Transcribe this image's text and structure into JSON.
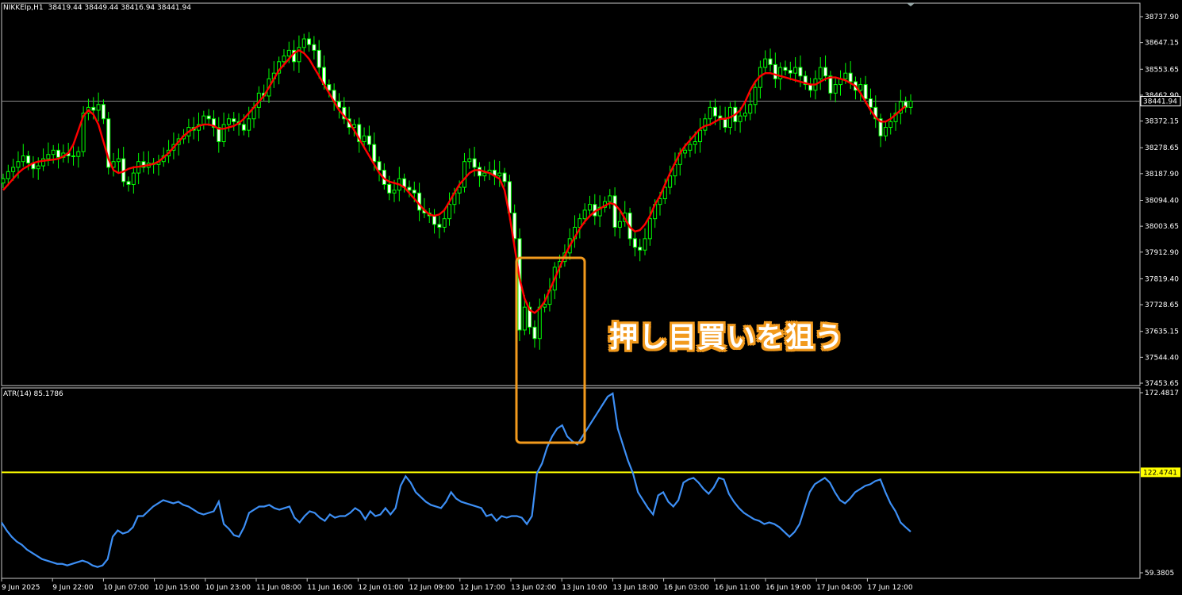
{
  "header": {
    "symbol": "NIKKEIp,H1",
    "ohlc": "38419.44 38449.44 38416.94 38441.94"
  },
  "indicator": {
    "label": "ATR(14) 85.1786"
  },
  "annotation": {
    "text": "押し目買いを狙う"
  },
  "colors": {
    "background": "#000000",
    "frame": "#c8c8c8",
    "candle": "#00ff00",
    "ma": "#ff0000",
    "atr": "#3d8ff5",
    "level": "#ffff00",
    "highlight": "#f29a1d"
  },
  "chart_data": [
    {
      "type": "candlestick",
      "title": "NIKKEIp,H1",
      "ylim": [
        37453.65,
        38787.0
      ],
      "y_ticks": [
        "38737.90",
        "38647.15",
        "38553.65",
        "38462.90",
        "38372.15",
        "38278.65",
        "38187.90",
        "38094.40",
        "38003.65",
        "37912.90",
        "37819.40",
        "37728.65",
        "37635.15",
        "37544.40",
        "37453.65"
      ],
      "y_tick_values": [
        38737.9,
        38647.15,
        38553.65,
        38462.9,
        38372.15,
        38278.65,
        38187.9,
        38094.4,
        38003.65,
        37912.9,
        37819.4,
        37728.65,
        37635.15,
        37544.4,
        37453.65
      ],
      "current_price": 38441.94,
      "current_price_label": "38441.94",
      "x_tick_labels": [
        "9 Jun 2025",
        "9 Jun 22:00",
        "10 Jun 07:00",
        "10 Jun 15:00",
        "10 Jun 23:00",
        "11 Jun 08:00",
        "11 Jun 16:00",
        "12 Jun 01:00",
        "12 Jun 09:00",
        "12 Jun 17:00",
        "13 Jun 02:00",
        "13 Jun 10:00",
        "13 Jun 18:00",
        "16 Jun 03:00",
        "16 Jun 11:00",
        "16 Jun 19:00",
        "17 Jun 04:00",
        "17 Jun 12:00"
      ],
      "candle_closes": [
        38170,
        38195,
        38210,
        38230,
        38250,
        38225,
        38205,
        38215,
        38240,
        38255,
        38270,
        38245,
        38260,
        38250,
        38248,
        38265,
        38400,
        38420,
        38410,
        38430,
        38380,
        38210,
        38230,
        38240,
        38160,
        38150,
        38190,
        38230,
        38210,
        38225,
        38220,
        38230,
        38250,
        38270,
        38290,
        38310,
        38320,
        38350,
        38340,
        38360,
        38390,
        38380,
        38350,
        38300,
        38360,
        38380,
        38370,
        38360,
        38340,
        38380,
        38420,
        38470,
        38460,
        38520,
        38540,
        38580,
        38600,
        38620,
        38580,
        38630,
        38660,
        38640,
        38620,
        38560,
        38500,
        38480,
        38440,
        38420,
        38380,
        38350,
        38360,
        38300,
        38320,
        38290,
        38230,
        38200,
        38150,
        38120,
        38130,
        38170,
        38140,
        38130,
        38120,
        38060,
        38050,
        38040,
        38010,
        38000,
        38030,
        38080,
        38120,
        38140,
        38230,
        38240,
        38210,
        38180,
        38190,
        38200,
        38180,
        38190,
        38160,
        38050,
        37960,
        37640,
        37720,
        37650,
        37610,
        37720,
        37730,
        37780,
        37860,
        37880,
        37910,
        37960,
        38000,
        38030,
        38060,
        38080,
        38040,
        38070,
        38090,
        38110,
        38000,
        38020,
        38050,
        37960,
        37930,
        37920,
        37960,
        38030,
        38080,
        38100,
        38140,
        38180,
        38220,
        38260,
        38270,
        38290,
        38300,
        38340,
        38380,
        38420,
        38390,
        38380,
        38350,
        38420,
        38370,
        38390,
        38400,
        38430,
        38490,
        38560,
        38590,
        38570,
        38520,
        38560,
        38550,
        38540,
        38560,
        38530,
        38500,
        38480,
        38520,
        38560,
        38530,
        38470,
        38500,
        38520,
        38540,
        38510,
        38480,
        38500,
        38450,
        38420,
        38380,
        38320,
        38350,
        38370,
        38400,
        38440,
        38420,
        38441.94
      ],
      "ma_values": [
        38130,
        38150,
        38170,
        38190,
        38205,
        38215,
        38225,
        38230,
        38233,
        38235,
        38237,
        38240,
        38248,
        38260,
        38290,
        38340,
        38390,
        38410,
        38395,
        38360,
        38300,
        38240,
        38200,
        38190,
        38195,
        38205,
        38210,
        38212,
        38215,
        38218,
        38222,
        38230,
        38245,
        38260,
        38280,
        38300,
        38320,
        38335,
        38345,
        38355,
        38360,
        38360,
        38355,
        38345,
        38345,
        38350,
        38355,
        38365,
        38380,
        38400,
        38420,
        38440,
        38460,
        38490,
        38520,
        38550,
        38570,
        38590,
        38610,
        38620,
        38610,
        38590,
        38560,
        38530,
        38500,
        38470,
        38440,
        38410,
        38390,
        38370,
        38340,
        38310,
        38280,
        38250,
        38220,
        38190,
        38170,
        38160,
        38155,
        38150,
        38140,
        38120,
        38100,
        38080,
        38060,
        38045,
        38040,
        38045,
        38060,
        38090,
        38120,
        38150,
        38170,
        38190,
        38200,
        38200,
        38195,
        38190,
        38180,
        38170,
        38130,
        38040,
        37930,
        37820,
        37750,
        37710,
        37700,
        37715,
        37740,
        37780,
        37820,
        37860,
        37900,
        37935,
        37965,
        37995,
        38020,
        38040,
        38055,
        38065,
        38075,
        38085,
        38080,
        38060,
        38030,
        38000,
        37985,
        37990,
        38010,
        38040,
        38080,
        38110,
        38150,
        38190,
        38225,
        38260,
        38285,
        38305,
        38325,
        38345,
        38355,
        38360,
        38370,
        38380,
        38380,
        38385,
        38395,
        38410,
        38440,
        38480,
        38510,
        38530,
        38540,
        38540,
        38535,
        38530,
        38525,
        38520,
        38515,
        38510,
        38505,
        38500,
        38500,
        38510,
        38520,
        38525,
        38525,
        38520,
        38515,
        38505,
        38495,
        38470,
        38440,
        38410,
        38385,
        38370,
        38370,
        38380,
        38395,
        38410,
        38425
      ]
    },
    {
      "type": "line",
      "title": "ATR(14) 85.1786",
      "ylim": [
        59.3805,
        172.4817
      ],
      "y_ticks": [
        "172.4817",
        "59.3805"
      ],
      "level": 122.4741,
      "level_label": "122.4741",
      "values": [
        91,
        86,
        82,
        79,
        77,
        74,
        72,
        70,
        68,
        67,
        66,
        65,
        65,
        64,
        65,
        66,
        67,
        66,
        64,
        63,
        64,
        68,
        82,
        86,
        84,
        85,
        88,
        95,
        95,
        98,
        101,
        103,
        105,
        104,
        103,
        104,
        102,
        101,
        99,
        97,
        96,
        97,
        98,
        104,
        90,
        87,
        83,
        82,
        88,
        97,
        99,
        101,
        101,
        102,
        100,
        99,
        100,
        101,
        94,
        91,
        95,
        98,
        97,
        94,
        92,
        96,
        94,
        95,
        95,
        97,
        100,
        98,
        93,
        98,
        95,
        96,
        100,
        96,
        100,
        114,
        120,
        116,
        110,
        107,
        104,
        102,
        101,
        100,
        104,
        110,
        106,
        104,
        103,
        102,
        101,
        100,
        95,
        96,
        92,
        95,
        94,
        95,
        95,
        94,
        90,
        95,
        122,
        128,
        138,
        145,
        150,
        152,
        145,
        142,
        140,
        145,
        150,
        155,
        160,
        165,
        170,
        172,
        150,
        140,
        130,
        122,
        110,
        105,
        100,
        96,
        108,
        110,
        104,
        101,
        105,
        116,
        118,
        119,
        116,
        112,
        109,
        113,
        119,
        118,
        109,
        104,
        100,
        97,
        95,
        93,
        92,
        90,
        91,
        90,
        88,
        85,
        82,
        85,
        90,
        100,
        110,
        115,
        117,
        119,
        116,
        110,
        105,
        103,
        106,
        110,
        112,
        114,
        115,
        117,
        118,
        110,
        103,
        98,
        91,
        88,
        85.18
      ]
    }
  ]
}
